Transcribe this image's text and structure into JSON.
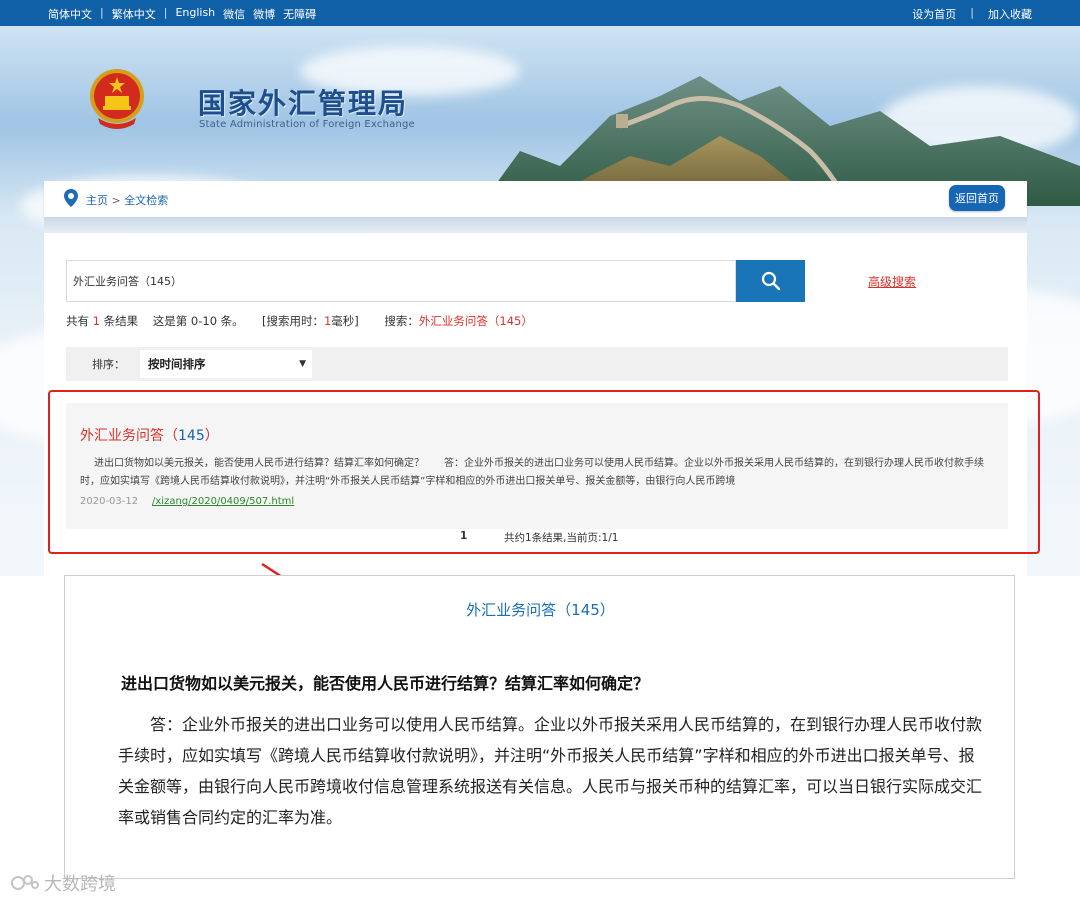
{
  "topbar": {
    "links_left": [
      "简体中文",
      "|",
      "繁体中文",
      "|",
      "English",
      "微信",
      "微博",
      "无障碍"
    ],
    "link_set_home": "设为首页",
    "separator": "|",
    "link_favorite": "加入收藏"
  },
  "header": {
    "title": "国家外汇管理局",
    "subtitle": "State Administration of Foreign Exchange"
  },
  "breadcrumb": {
    "home": "主页",
    "sep": ">",
    "current": "全文检索",
    "back_button": "返回首页"
  },
  "search": {
    "query": "外汇业务问答（145）",
    "advanced": "高级搜索"
  },
  "stats": {
    "prefix": "共有",
    "count": "1",
    "suffix": "条结果",
    "range": "这是第 0-10 条。",
    "time_prefix": "[搜索用时：",
    "time_value": "1",
    "time_suffix": "毫秒]",
    "query_label": "搜索：",
    "query_value": "外汇业务问答（145）"
  },
  "sort": {
    "label": "排序：",
    "selected": "按时间排序"
  },
  "result": {
    "title_text": "外汇业务问答（",
    "title_num": "145",
    "title_close": "）",
    "snippet": "进出口货物如以美元报关，能否使用人民币进行结算？结算汇率如何确定？　　答：企业外币报关的进出口业务可以使用人民币结算。企业以外币报关采用人民币结算的，在到银行办理人民币收付款手续时，应如实填写《跨境人民币结算收付款说明》，并注明“外币报关人民币结算”字样和相应的外币进出口报关单号、报关金额等，由银行向人民币跨境",
    "date": "2020-03-12",
    "link": "/xizang/2020/0409/507.html"
  },
  "pager": {
    "page": "1",
    "summary": "共约1条结果,当前页:1/1"
  },
  "article": {
    "title": "外汇业务问答（145）",
    "question": "进出口货物如以美元报关，能否使用人民币进行结算？结算汇率如何确定？",
    "answer": "答：企业外币报关的进出口业务可以使用人民币结算。企业以外币报关采用人民币结算的，在到银行办理人民币收付款手续时，应如实填写《跨境人民币结算收付款说明》，并注明“外币报关人民币结算”字样和相应的外币进出口报关单号、报关金额等，由银行向人民币跨境收付信息管理系统报送有关信息。人民币与报关币种的结算汇率，可以当日银行实际成交汇率或销售合同约定的汇率为准。"
  },
  "watermark": "大数跨境",
  "colors": {
    "topbar": "#1060a8",
    "accent_blue": "#1a74b8",
    "accent_red": "#d8322a",
    "highlight_border": "#e02020"
  }
}
